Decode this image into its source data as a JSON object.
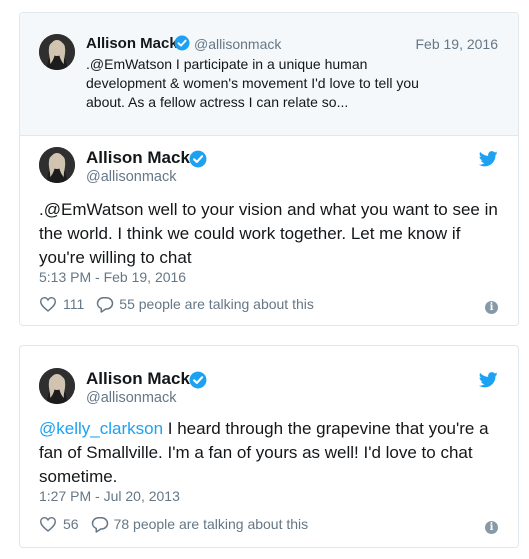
{
  "colors": {
    "accent": "#1da1f2",
    "secondary_text": "#657786",
    "border": "#e1e8ed",
    "quote_bg": "#f5f8fa"
  },
  "icons": [
    "verified-badge-icon",
    "twitter-bird-icon",
    "heart-icon",
    "reply-bubble-icon",
    "info-icon"
  ],
  "tweets": [
    {
      "quoted": {
        "name": "Allison Mack",
        "handle": "@allisonmack",
        "date": "Feb 19, 2016",
        "text": ".@EmWatson I participate in a unique human development & women's movement I'd love to tell you about. As a fellow actress I can relate so..."
      },
      "name": "Allison Mack",
      "handle": "@allisonmack",
      "text_mention": "",
      "text": ".@EmWatson well to your vision and what you want to see in the world. I think we could work together. Let me know if you're willing to chat",
      "timestamp": "5:13 PM - Feb 19, 2016",
      "likes": "111",
      "talking": "55 people are talking about this"
    },
    {
      "name": "Allison Mack",
      "handle": "@allisonmack",
      "text_mention": "@kelly_clarkson",
      "text": " I heard through the grapevine that you're a fan of Smallville. I'm a fan of yours as well! I'd love to chat sometime.",
      "timestamp": "1:27 PM - Jul 20, 2013",
      "likes": "56",
      "talking": "78 people are talking about this"
    }
  ]
}
